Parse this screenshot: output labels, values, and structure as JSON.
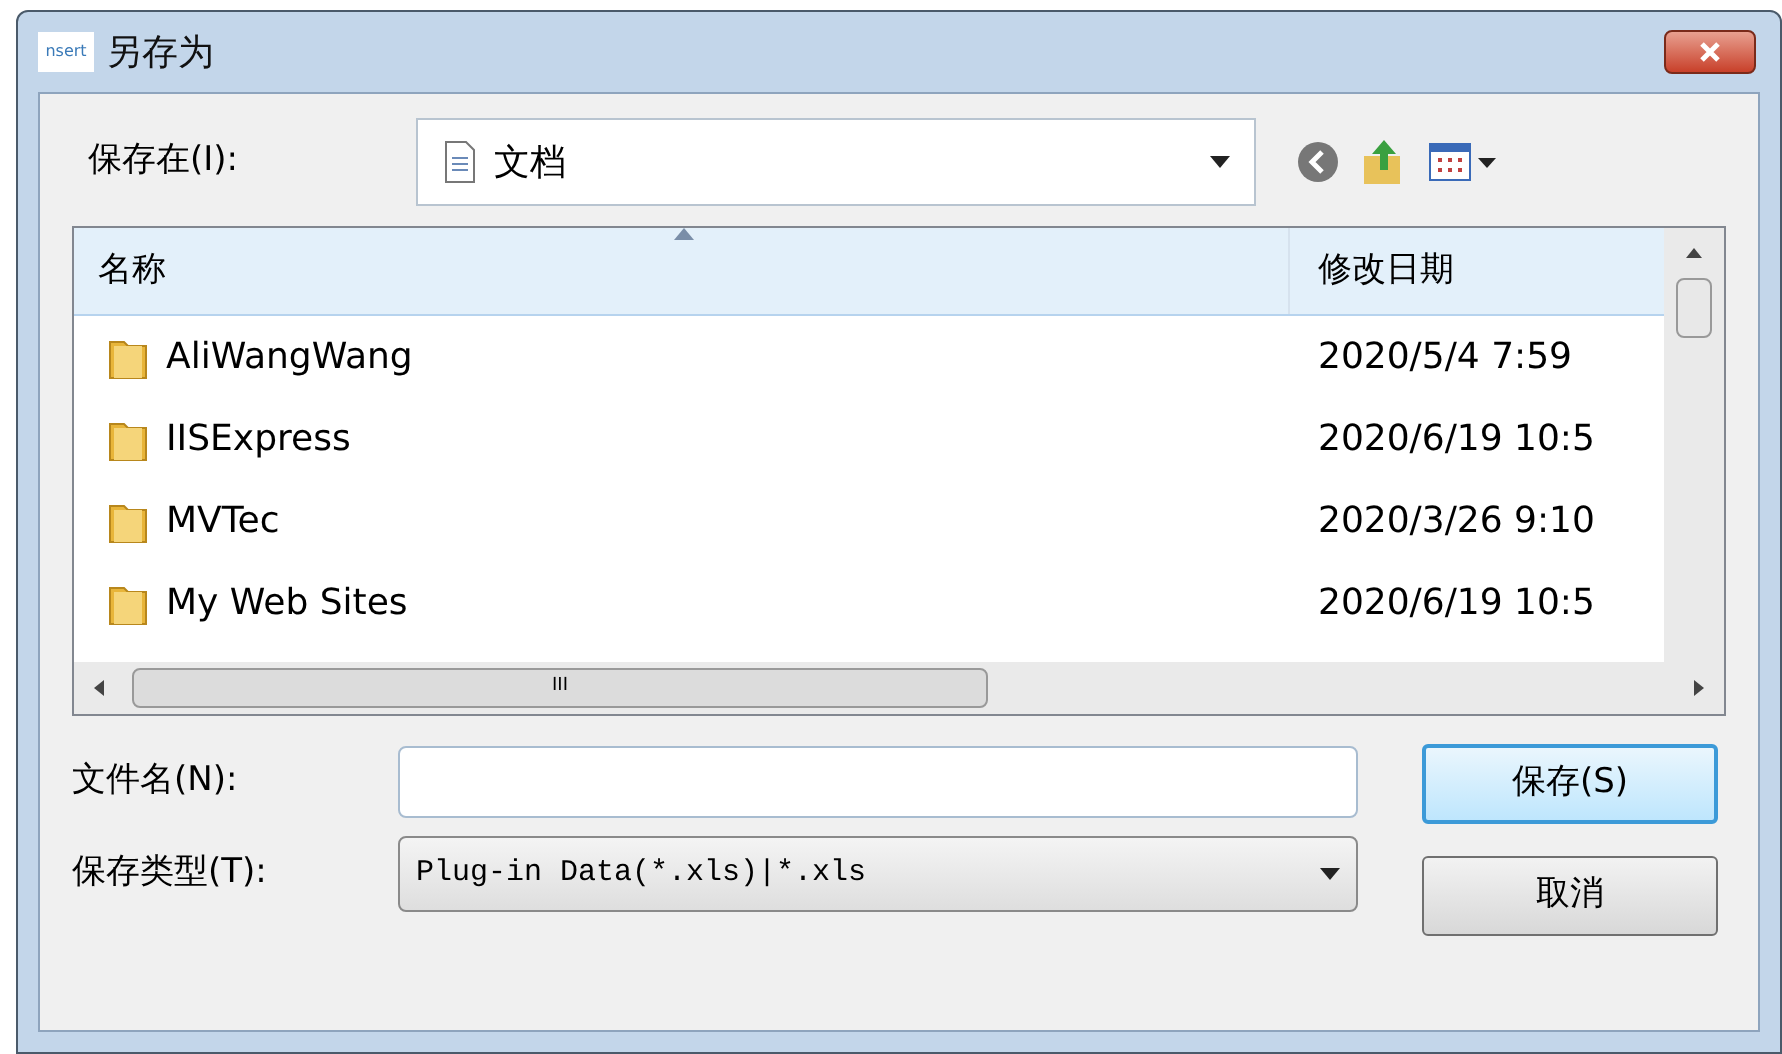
{
  "window": {
    "title": "另存为",
    "icon_text": "nsert"
  },
  "location": {
    "label": "保存在(I):",
    "value": "文档"
  },
  "file_list": {
    "columns": [
      "名称",
      "修改日期"
    ],
    "rows": [
      {
        "name": "AliWangWang",
        "date": "2020/5/4 7:59"
      },
      {
        "name": "IISExpress",
        "date": "2020/6/19 10:5"
      },
      {
        "name": "MVTec",
        "date": "2020/3/26 9:10"
      },
      {
        "name": "My Web Sites",
        "date": "2020/6/19 10:5"
      }
    ],
    "scroll_thumb_text": "III"
  },
  "file_name": {
    "label": "文件名(N):"
  },
  "file_type": {
    "label": "保存类型(T):",
    "value": "Plug-in Data(*.xls)|*.xls"
  },
  "buttons": [
    {
      "label": "保存(S)",
      "default": true
    },
    {
      "label": "取消",
      "default": false
    }
  ]
}
